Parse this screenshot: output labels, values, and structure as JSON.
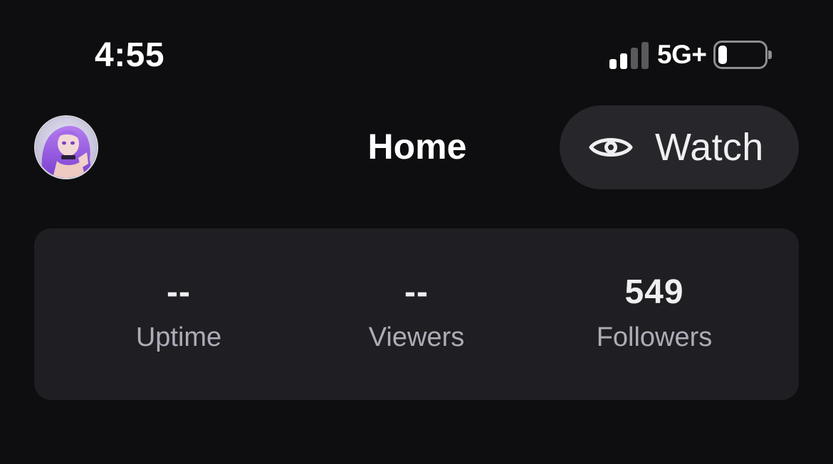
{
  "status_bar": {
    "time": "4:55",
    "network": "5G+",
    "signal_bars_active": 2,
    "signal_bars_total": 4,
    "battery_level": 0.15
  },
  "header": {
    "title": "Home",
    "watch_button_label": "Watch",
    "watch_icon": "eye-icon",
    "avatar": "profile-avatar"
  },
  "stats": [
    {
      "value": "--",
      "label": "Uptime"
    },
    {
      "value": "--",
      "label": "Viewers"
    },
    {
      "value": "549",
      "label": "Followers"
    }
  ],
  "colors": {
    "background": "#0e0e10",
    "card": "#1f1f23",
    "button": "#26262b",
    "text_primary": "#efeff1",
    "text_secondary": "#adadb8",
    "avatar_purple": "#9b5de5"
  }
}
